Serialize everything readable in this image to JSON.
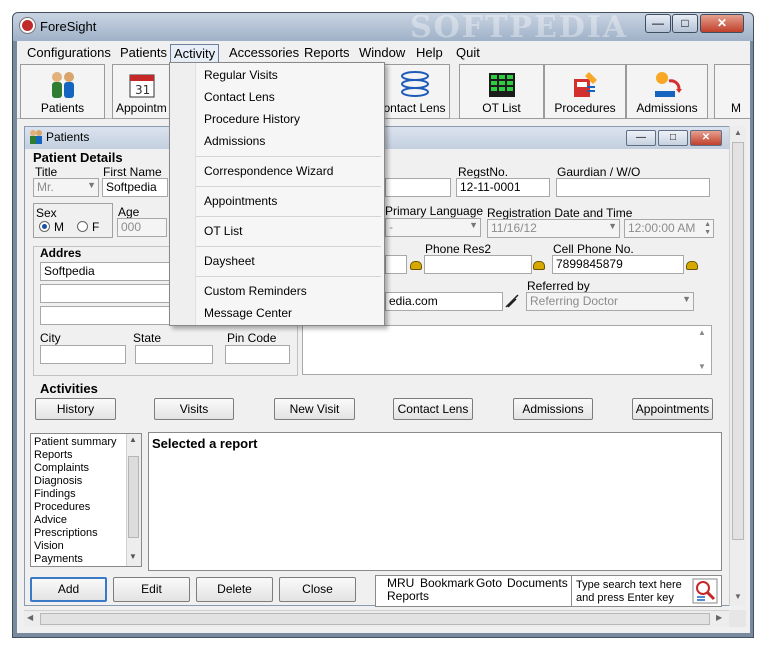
{
  "window": {
    "title": "ForeSight",
    "watermark": "SOFTPEDIA",
    "controls": {
      "minimize": "—",
      "maximize": "□",
      "close": "✕"
    }
  },
  "menu": [
    "Configurations",
    "Patients",
    "Activity",
    "Accessories",
    "Reports",
    "Window",
    "Help",
    "Quit"
  ],
  "toolbar": {
    "patients": "Patients",
    "appointments": "Appointm",
    "contact_lens": "ontact Lens",
    "ot_list": "OT List",
    "procedures": "Procedures",
    "admissions": "Admissions",
    "more": "M"
  },
  "activity_menu": {
    "items": [
      "Regular Visits",
      "Contact Lens",
      "Procedure History",
      "Admissions",
      "Correspondence Wizard",
      "Appointments",
      "OT List",
      "Daysheet",
      "Custom Reminders",
      "Message Center"
    ]
  },
  "child": {
    "title": "Patients",
    "controls": {
      "minimize": "—",
      "maximize": "□",
      "close": "✕"
    }
  },
  "patient": {
    "section_title": "Patient Details",
    "labels": {
      "title": "Title",
      "first_name": "First Name",
      "regst_no": "RegstNo.",
      "guardian": "Gaurdian / W/O",
      "sex": "Sex",
      "male": "M",
      "female": "F",
      "age": "Age",
      "primary_language": "Primary Language",
      "reg_date_time": "Registration Date and Time",
      "address": "Addres",
      "phone_res2": "Phone Res2",
      "cell_phone": "Cell Phone No.",
      "referred_by": "Referred by",
      "city": "City",
      "state": "State",
      "pin_code": "Pin Code"
    },
    "values": {
      "title": "Mr.",
      "first_name": "Softpedia",
      "regst_no": "12-11-0001",
      "age": "000",
      "primary_language": "-",
      "reg_date": "11/16/12",
      "reg_time": "12:00:00 AM",
      "address_line1": "Softpedia",
      "cell_phone": "7899845879",
      "email_fragment": "edia.com",
      "referring_doctor": "Referring Doctor"
    }
  },
  "activities": {
    "section_title": "Activities",
    "buttons": [
      "History",
      "Visits",
      "New Visit",
      "Contact Lens",
      "Admissions",
      "Appointments"
    ]
  },
  "report_list": [
    "Patient summary",
    "Reports",
    "Complaints",
    "Diagnosis",
    "Findings",
    "Procedures",
    "Advice",
    "Prescriptions",
    "Vision",
    "Payments"
  ],
  "report_panel": {
    "heading": "Selected a report"
  },
  "bottom_buttons": {
    "add": "Add",
    "edit": "Edit",
    "delete": "Delete",
    "close": "Close"
  },
  "bottom_links": {
    "mru": "MRU",
    "bookmark": "Bookmark",
    "goto": "Goto",
    "documents": "Documents",
    "reports": "Reports"
  },
  "search_hint": {
    "line1": "Type search text here",
    "line2": "and press Enter key"
  },
  "colors": {
    "title_bar": "#b4c3d6",
    "menu_highlight": "#e8eef7",
    "client": "#f0f0f0",
    "default_button_border": "#3a78c8"
  }
}
